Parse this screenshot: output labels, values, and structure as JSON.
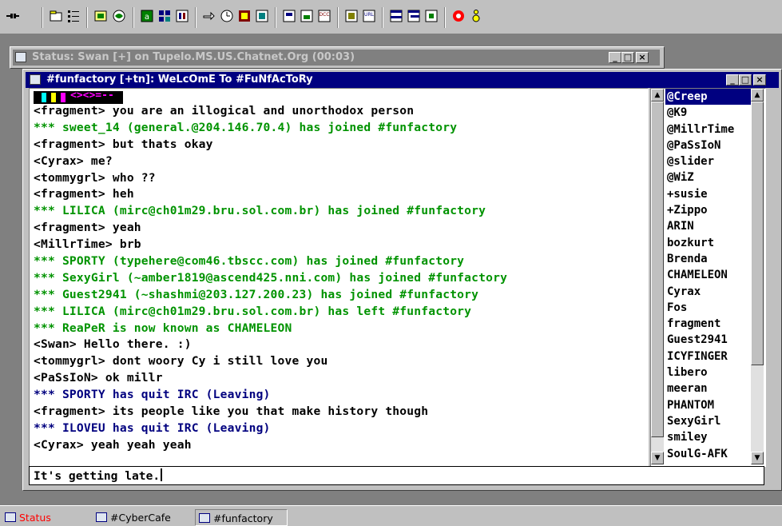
{
  "status_window": {
    "title": "Status: Swan [+] on Tupelo.MS.US.Chatnet.Org (00:03)"
  },
  "channel_window": {
    "title": "#funfactory [+tn]: WeLcOmE To #FuNfAcToRy",
    "topic_banner_text": "<><>=--",
    "chat_lines": [
      {
        "text": "<fragment> you are an illogical and unorthodox person",
        "type": "msg"
      },
      {
        "text": "*** sweet_14 (general.@204.146.70.4) has joined #funfactory",
        "type": "join"
      },
      {
        "text": "<fragment> but thats okay",
        "type": "msg"
      },
      {
        "text": "<Cyrax> me?",
        "type": "msg"
      },
      {
        "text": "<tommygrl> who ??",
        "type": "msg"
      },
      {
        "text": "<fragment> heh",
        "type": "msg"
      },
      {
        "text": "*** LILICA (mirc@ch01m29.bru.sol.com.br) has joined #funfactory",
        "type": "join"
      },
      {
        "text": "<fragment> yeah",
        "type": "msg"
      },
      {
        "text": "<MillrTime> brb",
        "type": "msg"
      },
      {
        "text": "*** SPORTY (typehere@com46.tbscc.com) has joined #funfactory",
        "type": "join"
      },
      {
        "text": "*** SexyGirl (~amber1819@ascend425.nni.com) has joined #funfactory",
        "type": "join"
      },
      {
        "text": "*** Guest2941 (~shashmi@203.127.200.23) has joined #funfactory",
        "type": "join"
      },
      {
        "text": "*** LILICA (mirc@ch01m29.bru.sol.com.br) has left #funfactory",
        "type": "join"
      },
      {
        "text": "*** ReaPeR is now known as CHAMELEON",
        "type": "nick"
      },
      {
        "text": "<Swan> Hello there. :)",
        "type": "msg"
      },
      {
        "text": "<tommygrl> dont woory Cy i still love you",
        "type": "msg"
      },
      {
        "text": "<PaSsIoN> ok millr",
        "type": "msg"
      },
      {
        "text": "*** SPORTY has quit IRC (Leaving)",
        "type": "quit"
      },
      {
        "text": "<fragment> its people like you that make history though",
        "type": "msg"
      },
      {
        "text": "*** ILOVEU has quit IRC (Leaving)",
        "type": "quit"
      },
      {
        "text": "<Cyrax> yeah yeah yeah",
        "type": "msg"
      }
    ],
    "nicklist": [
      "@Creep",
      "@K9",
      "@MillrTime",
      "@PaSsIoN",
      "@slider",
      "@WiZ",
      "+susie",
      "+Zippo",
      "ARIN",
      "bozkurt",
      "Brenda",
      "CHAMELEON",
      "Cyrax",
      "Fos",
      "fragment",
      "Guest2941",
      "ICYFINGER",
      "libero",
      "meeran",
      "PHANTOM",
      "SexyGirl",
      "smiley",
      "SoulG-AFK"
    ],
    "selected_nick": "@Creep",
    "input_value": "It's getting late."
  },
  "taskbar": {
    "tasks": [
      {
        "label": "Status",
        "color": "#ff0000"
      },
      {
        "label": "#CyberCafe",
        "color": "#000000"
      },
      {
        "label": "#funfactory",
        "color": "#000000"
      }
    ]
  },
  "toolbar": {
    "buttons": [
      "connect-icon",
      "options-icon",
      "list-channels-icon",
      "channel-folder-icon",
      "scripts-icon",
      "address-book-icon",
      "aliases-icon",
      "notify-icon",
      "finger-icon",
      "timer-icon",
      "remote-icon",
      "dcc-send-icon",
      "dcc-chat-icon",
      "dcc-icon",
      "notes-icon",
      "url-icon",
      "tile-horizontal-icon",
      "tile-vertical-icon",
      "arrange-icon",
      "help-icon",
      "about-icon"
    ]
  },
  "colors": {
    "active_title": "#000080",
    "inactive_title": "#808080",
    "join_text": "#009300",
    "quit_text": "#00007f"
  }
}
